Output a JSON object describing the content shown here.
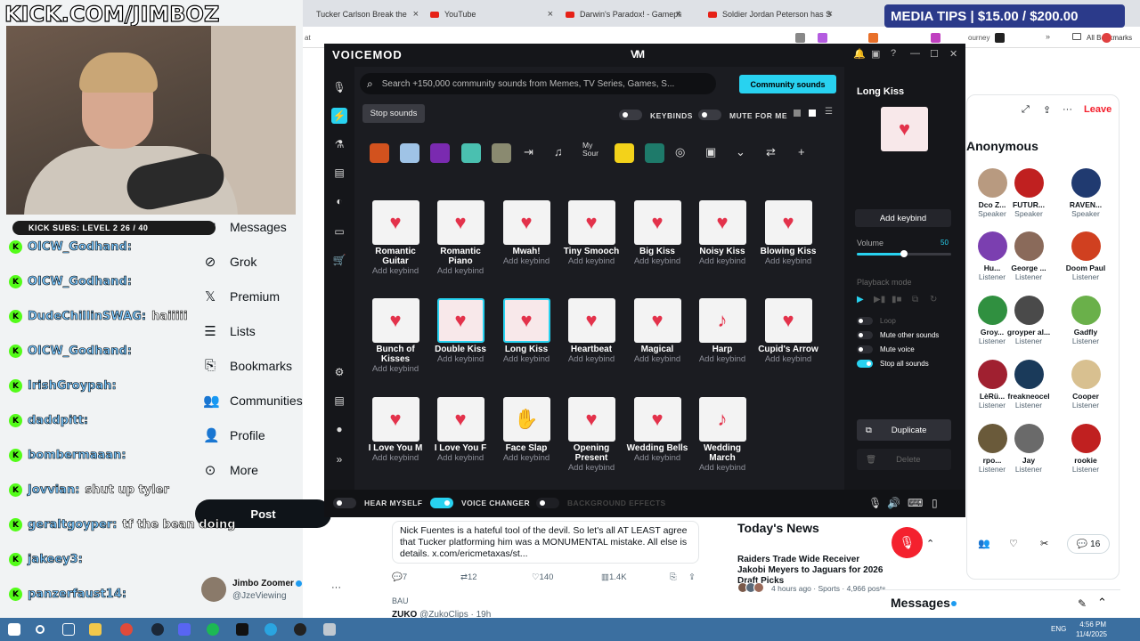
{
  "browser": {
    "tabs": [
      {
        "label": "Tucker Carlson Break the"
      },
      {
        "label": "YouTube"
      },
      {
        "label": "Darwin's Paradox! - Gameplay"
      },
      {
        "label": "Soldier Jordan Peterson has S"
      }
    ],
    "partial_labels": {
      "left": "at",
      "journey": "ourney",
      "bookmarks": "All Bookmarks"
    }
  },
  "overlay": {
    "kick_url": "KICK.COM/JIMBOZ",
    "media_tips": "MEDIA TIPS | $15.00 / $200.00",
    "kick_subs": "KICK SUBS: LEVEL 2 26 / 40",
    "chat": [
      {
        "user": "OICW_Godhand:",
        "message": ""
      },
      {
        "user": "OICW_Godhand:",
        "message": ""
      },
      {
        "user": "DudeChillinSWAG:",
        "message": "haiiiii"
      },
      {
        "user": "OICW_Godhand:",
        "message": ""
      },
      {
        "user": "IrishGroypah:",
        "message": ""
      },
      {
        "user": "daddpitt:",
        "message": ""
      },
      {
        "user": "bombermaaan:",
        "message": ""
      },
      {
        "user": "Jovvian:",
        "message": "shut up tyler"
      },
      {
        "user": "geraltgoyper:",
        "message": "tf the bean doing"
      },
      {
        "user": "jakeey3:",
        "message": ""
      },
      {
        "user": "panzerfaust14:",
        "message": ""
      }
    ]
  },
  "x_nav": {
    "items": [
      {
        "label": "Messages",
        "icon": "envelope-icon"
      },
      {
        "label": "Grok",
        "icon": "grok-icon"
      },
      {
        "label": "Premium",
        "icon": "x-logo-icon"
      },
      {
        "label": "Lists",
        "icon": "list-icon"
      },
      {
        "label": "Bookmarks",
        "icon": "bookmark-icon"
      },
      {
        "label": "Communities",
        "icon": "people-icon"
      },
      {
        "label": "Profile",
        "icon": "person-icon"
      },
      {
        "label": "More",
        "icon": "more-circle-icon"
      }
    ],
    "post_label": "Post",
    "user": {
      "name": "Jimbo Zoomer",
      "handle": "@JzeViewing"
    }
  },
  "tweet": {
    "text": "Nick Fuentes is a hateful tool of the devil. So let's all AT LEAST agree that Tucker platforming him was a MONUMENTAL mistake. All else is details. x.com/ericmetaxas/st...",
    "replies": "7",
    "reposts": "12",
    "likes": "140",
    "views": "1.4K",
    "next_label": "BAU",
    "next_user": "ZUKO",
    "next_handle": "@ZukoClips · 19h"
  },
  "news": {
    "title": "Today's News",
    "item": "Raiders Trade Wide Receiver Jakobi Meyers to Jaguars for 2026 Draft Picks",
    "meta": "4 hours ago · Sports · 4,966 posts"
  },
  "space": {
    "title": "Anonymous",
    "leave": "Leave",
    "people": [
      {
        "name": "Dco Z...",
        "role": "Speaker",
        "color": "#b89a80"
      },
      {
        "name": "FUTUR...",
        "role": "Speaker",
        "color": "#c02020"
      },
      {
        "name": "RAVEN...",
        "role": "Speaker",
        "color": "#203a70"
      },
      {
        "name": "Hu...",
        "role": "Listener",
        "color": "#7b3fb0"
      },
      {
        "name": "George ...",
        "role": "Listener",
        "color": "#8a6a5a"
      },
      {
        "name": "Doom Paul",
        "role": "Listener",
        "color": "#d04020"
      },
      {
        "name": "Groy...",
        "role": "Listener",
        "color": "#309040"
      },
      {
        "name": "groyper al...",
        "role": "Listener",
        "color": "#4a4a4a"
      },
      {
        "name": "Gadfly",
        "role": "Listener",
        "color": "#6ab04a"
      },
      {
        "name": "LèRü...",
        "role": "Listener",
        "color": "#a02030"
      },
      {
        "name": "freakneocel",
        "role": "Listener",
        "color": "#1a3a5a"
      },
      {
        "name": "Cooper",
        "role": "Listener",
        "color": "#d8c090"
      },
      {
        "name": "rpo...",
        "role": "Listener",
        "color": "#6a5a3a"
      },
      {
        "name": "Jay",
        "role": "Listener",
        "color": "#6a6a6a"
      },
      {
        "name": "rookie",
        "role": "Listener",
        "color": "#c02020"
      }
    ],
    "listener_count": "16",
    "messages_label": "Messages"
  },
  "voicemod": {
    "logo": "VOICEMOD",
    "mark": "VM",
    "search_placeholder": "Search +150,000 community sounds from Memes, TV Series, Games, S...",
    "community_label": "Community sounds",
    "stop_label": "Stop sounds",
    "keybinds_label": "KEYBINDS",
    "mute_label": "MUTE FOR ME",
    "category_text": "My Sour",
    "add_keybind_small": "Add keybind",
    "sounds": [
      {
        "name": "Romantic Guitar",
        "glyph": "♥"
      },
      {
        "name": "Romantic Piano",
        "glyph": "♥"
      },
      {
        "name": "Mwah!",
        "glyph": "♥"
      },
      {
        "name": "Tiny Smooch",
        "glyph": "♥"
      },
      {
        "name": "Big Kiss",
        "glyph": "♥"
      },
      {
        "name": "Noisy Kiss",
        "glyph": "♥"
      },
      {
        "name": "Blowing Kiss",
        "glyph": "♥"
      },
      {
        "name": "Bunch of Kisses",
        "glyph": "♥"
      },
      {
        "name": "Double Kiss",
        "glyph": "♥"
      },
      {
        "name": "Long Kiss",
        "glyph": "♥"
      },
      {
        "name": "Heartbeat",
        "glyph": "♥"
      },
      {
        "name": "Magical",
        "glyph": "♥"
      },
      {
        "name": "Harp",
        "glyph": "♪"
      },
      {
        "name": "Cupid's Arrow",
        "glyph": "♥"
      },
      {
        "name": "I Love You M",
        "glyph": "♥"
      },
      {
        "name": "I Love You F",
        "glyph": "♥"
      },
      {
        "name": "Face Slap",
        "glyph": "✋"
      },
      {
        "name": "Opening Present",
        "glyph": "♥"
      },
      {
        "name": "Wedding Bells",
        "glyph": "♥"
      },
      {
        "name": "Wedding March",
        "glyph": "♪"
      }
    ],
    "panel": {
      "title": "Long Kiss",
      "add_keybind": "Add keybind",
      "volume_label": "Volume",
      "volume_value": "50",
      "volume_fraction": 0.5,
      "playback_label": "Playback mode",
      "options": [
        {
          "label": "Loop",
          "on": false,
          "dim": true
        },
        {
          "label": "Mute other sounds",
          "on": false,
          "dim": false
        },
        {
          "label": "Mute voice",
          "on": false,
          "dim": false
        },
        {
          "label": "Stop all sounds",
          "on": true,
          "dim": false
        }
      ],
      "duplicate_label": "Duplicate",
      "delete_label": "Delete"
    },
    "bottom": {
      "hear_myself": "HEAR MYSELF",
      "voice_changer": "VOICE CHANGER",
      "background_effects": "BACKGROUND EFFECTS"
    },
    "accent": "#28d2f0"
  },
  "taskbar": {
    "lang": "ENG",
    "time": "4:56 PM",
    "date": "11/4/2025"
  }
}
